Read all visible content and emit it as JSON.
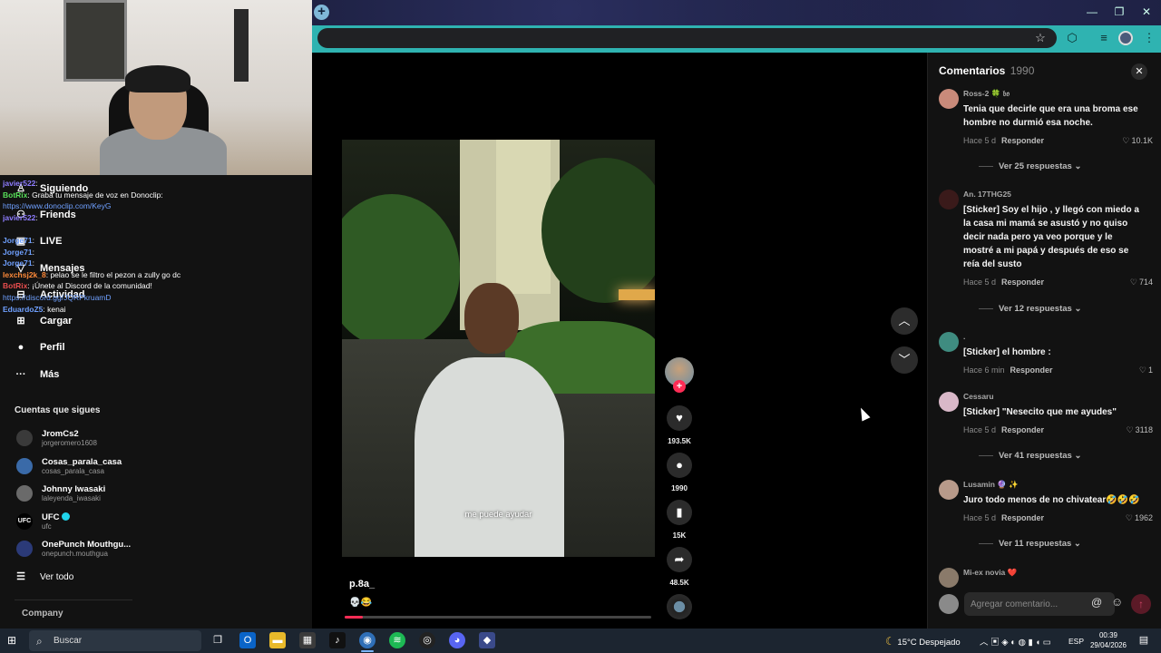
{
  "browser": {
    "new_tab_label": "+",
    "min_glyph": "—",
    "max_glyph": "❐",
    "close_glyph": "✕",
    "icons": [
      "star-icon",
      "extensions-icon",
      "media-icon",
      "profile-icon",
      "menu-icon"
    ]
  },
  "stream_chat": [
    {
      "user": "javier522",
      "text": ":",
      "color": "#8e7dff"
    },
    {
      "user": "BotRix",
      "text": ": Graba tu mensaje de voz en Donoclip:",
      "color": "#58e05a"
    },
    {
      "user": "",
      "text": "https://www.donoclip.com/KeyG",
      "color": "#6fa0ff"
    },
    {
      "user": "javier522",
      "text": ":",
      "color": "#8e7dff"
    },
    {
      "user": "Jorge71",
      "text": ":",
      "color": "#6fa0ff"
    },
    {
      "user": "Jorge71",
      "text": ":",
      "color": "#6fa0ff"
    },
    {
      "user": "Jorge71",
      "text": ":",
      "color": "#6fa0ff"
    },
    {
      "user": "lexchsj2k_8",
      "text": ": pelao se le filtro el pezon a zully go dc",
      "color": "#ff8a3a"
    },
    {
      "user": "BotRix",
      "text": ": ¡Únete al Discord de la comunidad!",
      "color": "#e84d4d"
    },
    {
      "user": "",
      "text": "https://discord.gg/JQRPkruamD",
      "color": "#6fa0ff"
    },
    {
      "user": "EduardoZ5",
      "text": ": kenai",
      "color": "#6fa0ff"
    }
  ],
  "sidebar": {
    "nav": [
      {
        "label": "Siguiendo",
        "icon": "following-icon",
        "glyph": "♙"
      },
      {
        "label": "Friends",
        "icon": "friends-icon",
        "glyph": "⚇"
      },
      {
        "label": "LIVE",
        "icon": "live-icon",
        "glyph": "▣"
      },
      {
        "label": "Mensajes",
        "icon": "messages-icon",
        "glyph": "▽"
      },
      {
        "label": "Actividad",
        "icon": "activity-icon",
        "glyph": "⊟"
      },
      {
        "label": "Cargar",
        "icon": "upload-icon",
        "glyph": "⊞"
      },
      {
        "label": "Perfil",
        "icon": "profile-icon",
        "glyph": "●"
      },
      {
        "label": "Más",
        "icon": "more-icon",
        "glyph": "···"
      }
    ],
    "following_title": "Cuentas que sigues",
    "accounts": [
      {
        "name": "JromCs2",
        "user": "jorgeromero1608",
        "avatar_color": "#3a3a3a",
        "verified": false
      },
      {
        "name": "Cosas_parala_casa",
        "user": "cosas_parala_casa",
        "avatar_color": "#3a6aa8",
        "verified": false
      },
      {
        "name": "Johnny Iwasaki",
        "user": "laleyenda_iwasaki",
        "avatar_color": "#6a6a6a",
        "verified": false
      },
      {
        "name": "UFC",
        "user": "ufc",
        "avatar_color": "#000000",
        "verified": true,
        "avatar_text": "UFC"
      },
      {
        "name": "OnePunch Mouthgu...",
        "user": "onepunch.mouthgua",
        "avatar_color": "#2b3a78",
        "verified": false
      }
    ],
    "see_all": "Ver todo",
    "company": "Company"
  },
  "video": {
    "subtitle": "me puede ayudar",
    "author": "p.8a_",
    "description": "💀😂",
    "progress": 0.06,
    "likes": "193.5K",
    "comments": "1990",
    "saves": "15K",
    "shares": "48.5K"
  },
  "comments_panel": {
    "title": "Comentarios",
    "count": "1990",
    "close_glyph": "✕",
    "comments": [
      {
        "user": "Ross-2 🍀 𝔟𝔬",
        "text": "Tenia que decirle que era una broma ese hombre no durmió esa noche.",
        "time": "Hace 5 d",
        "reply": "Responder",
        "likes": "10.1K",
        "more": "Ver 25 respuestas",
        "avatar_color": "#c98a7a"
      },
      {
        "user": "An. 17THG25",
        "text": "[Sticker] Soy el hijo , y llegó con miedo a la casa mi mamá se asustó y no quiso decir nada pero ya veo porque y le mostré a mi papá y después de eso se reía del susto",
        "time": "Hace 5 d",
        "reply": "Responder",
        "likes": "714",
        "more": "Ver 12 respuestas",
        "avatar_color": "#3a1a1a"
      },
      {
        "user": ".",
        "text": "[Sticker] el hombre :",
        "time": "Hace 6 min",
        "reply": "Responder",
        "likes": "1",
        "more": "",
        "avatar_color": "#3f8c80"
      },
      {
        "user": "Cessaru",
        "text": "[Sticker] \"Nesecito que me ayudes\"",
        "time": "Hace 5 d",
        "reply": "Responder",
        "likes": "3118",
        "more": "Ver 41 respuestas",
        "avatar_color": "#d9b8c8"
      },
      {
        "user": "Lusamin 🔮 ✨",
        "text": "Juro todo menos de no chivatear🤣🤣🤣",
        "time": "Hace 5 d",
        "reply": "Responder",
        "likes": "1962",
        "more": "Ver 11 respuestas",
        "avatar_color": "#b89a8a"
      },
      {
        "user": "Mi-ex novia ❤️",
        "text": "",
        "time": "",
        "reply": "",
        "likes": "",
        "more": "",
        "avatar_color": "#8a7a6a"
      }
    ],
    "input_placeholder": "Agregar comentario...",
    "at_glyph": "@",
    "emoji_glyph": "☺",
    "send_glyph": "↑"
  },
  "taskbar": {
    "search_placeholder": "Buscar",
    "weather": "15°C  Despejado",
    "language": "ESP",
    "time": "00:39",
    "date": "29/04/2026"
  }
}
